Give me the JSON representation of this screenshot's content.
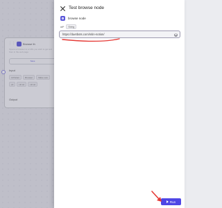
{
  "background": {
    "node_card": {
      "title": "Browse th",
      "description": "Opens a browser to a URL you wish to get text from in the web page",
      "save_label": "Save",
      "input_label": "Input",
      "param_chips": [
        "Id Param",
        "Browser",
        "Make sure"
      ],
      "param_chips2": [
        "url",
        "Url str",
        "Url str"
      ],
      "output_label": "Output"
    }
  },
  "panel": {
    "title": "Test browse node",
    "node_name": "browse node",
    "field_key": "url*",
    "field_type": "String",
    "url_value": "https://duetbots.com/nitin-notion/"
  },
  "actions": {
    "run_label": "Run"
  },
  "colors": {
    "accent": "#4f46e5",
    "annotation": "#e53935"
  }
}
